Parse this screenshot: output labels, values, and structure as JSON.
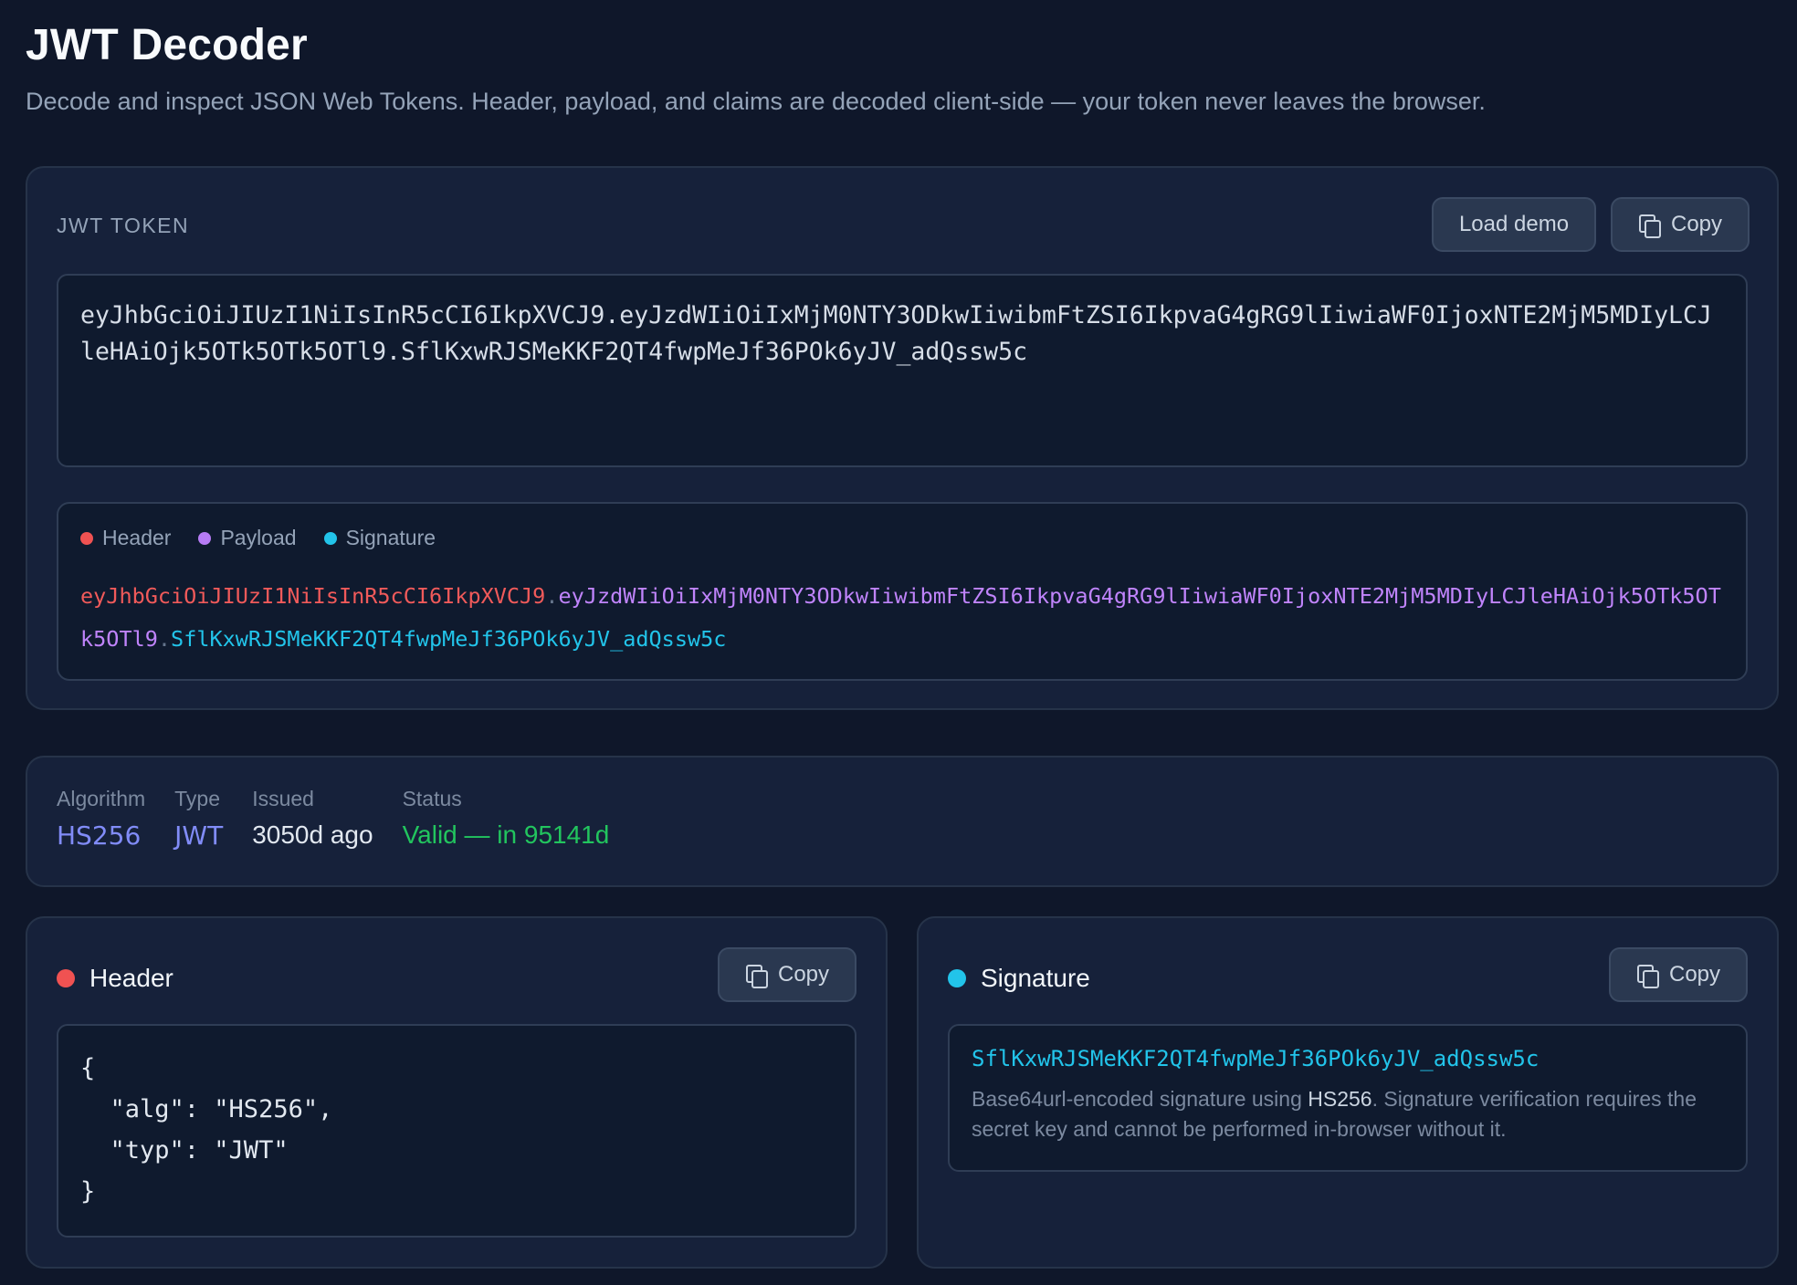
{
  "page": {
    "title": "JWT Decoder",
    "subtitle": "Decode and inspect JSON Web Tokens. Header, payload, and claims are decoded client-side — your token never leaves the browser."
  },
  "token_section": {
    "label": "JWT TOKEN",
    "load_demo_label": "Load demo",
    "copy_label": "Copy",
    "token_value": "eyJhbGciOiJIUzI1NiIsInR5cCI6IkpXVCJ9.eyJzdWIiOiIxMjM0NTY3ODkwIiwibmFtZSI6IkpvaG4gRG9lIiwiaWF0IjoxNTE2MjM5MDIyLCJleHAiOjk5OTk5OTk5OTl9.SflKxwRJSMeKKF2QT4fwpMeJf36POk6yJV_adQssw5c",
    "legend": {
      "header": "Header",
      "payload": "Payload",
      "signature": "Signature"
    },
    "segments": {
      "header": "eyJhbGciOiJIUzI1NiIsInR5cCI6IkpXVCJ9",
      "payload": "eyJzdWIiOiIxMjM0NTY3ODkwIiwibmFtZSI6IkpvaG4gRG9lIiwiaWF0IjoxNTE2MjM5MDIyLCJleHAiOjk5OTk5OTk5OTl9",
      "signature": "SflKxwRJSMeKKF2QT4fwpMeJf36POk6yJV_adQssw5c",
      "separator": "."
    }
  },
  "meta": {
    "algorithm": {
      "label": "Algorithm",
      "value": "HS256"
    },
    "type": {
      "label": "Type",
      "value": "JWT"
    },
    "issued": {
      "label": "Issued",
      "value": "3050d ago"
    },
    "status": {
      "label": "Status",
      "value": "Valid — in 95141d"
    }
  },
  "header_panel": {
    "title": "Header",
    "copy_label": "Copy",
    "json": "{\n  \"alg\": \"HS256\",\n  \"typ\": \"JWT\"\n}"
  },
  "signature_panel": {
    "title": "Signature",
    "copy_label": "Copy",
    "value": "SflKxwRJSMeKKF2QT4fwpMeJf36POk6yJV_adQssw5c",
    "desc_prefix": "Base64url-encoded signature using ",
    "desc_alg": "HS256",
    "desc_suffix": ". Signature verification requires the secret key and cannot be performed in-browser without it."
  },
  "colors": {
    "background": "#0f172a",
    "card": "#16213a",
    "header_red": "#f05252",
    "payload_purple": "#c084fc",
    "signature_cyan": "#22c4ea",
    "status_green": "#22c55e",
    "accent_indigo": "#818cf8"
  },
  "icons": {
    "copy": "copy-icon",
    "resize": "resize-grip-icon"
  }
}
